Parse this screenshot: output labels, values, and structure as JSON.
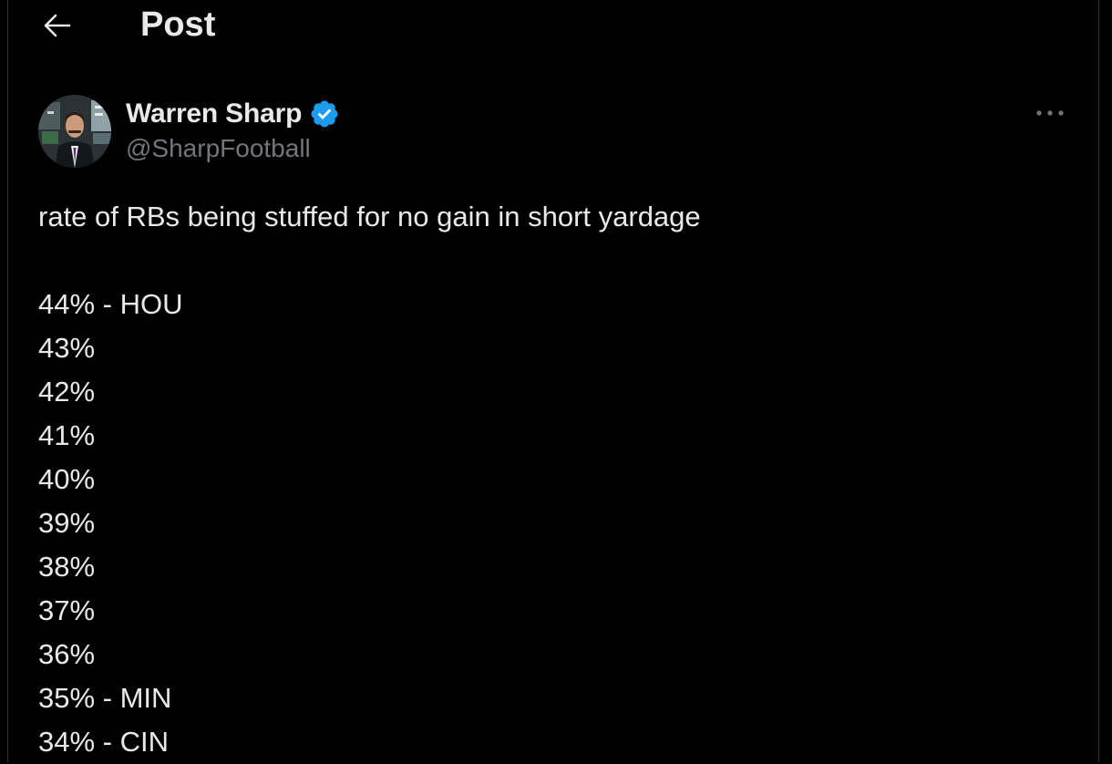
{
  "header": {
    "title": "Post",
    "back_icon": "arrow-left-icon"
  },
  "author": {
    "display_name": "Warren Sharp",
    "handle": "@SharpFootball",
    "verified_icon": "verified-badge-icon",
    "verified_color": "#1d9bf0",
    "more_icon": "more-horizontal-icon"
  },
  "post": {
    "lines": [
      "rate of RBs being stuffed for no gain in short yardage",
      "",
      "44% - HOU",
      "43%",
      "42%",
      "41%",
      "40%",
      "39%",
      "38%",
      "37%",
      "36%",
      "35% - MIN",
      "34% - CIN"
    ]
  },
  "colors": {
    "background": "#000000",
    "text_primary": "#e7e9ea",
    "text_secondary": "#71767b",
    "accent": "#1d9bf0",
    "border": "#2f3336"
  }
}
